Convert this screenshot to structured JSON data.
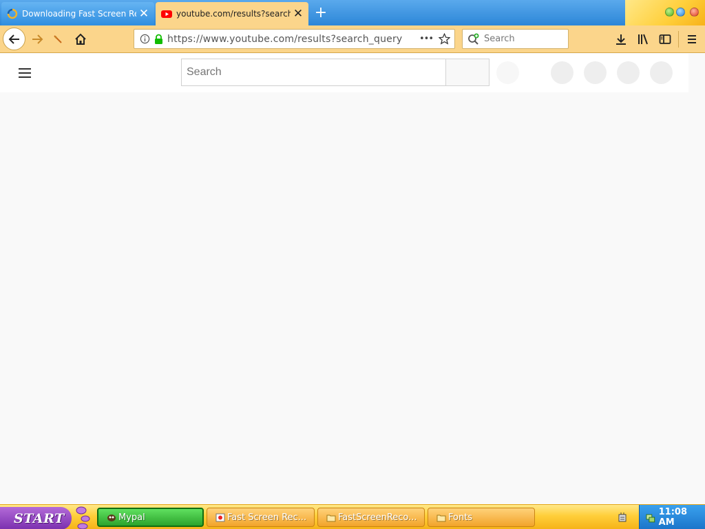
{
  "browser": {
    "tabs": [
      {
        "label": "Downloading Fast Screen Re",
        "active": false
      },
      {
        "label": "youtube.com/results?search",
        "active": true
      }
    ],
    "new_tab_symbol": "+",
    "close_symbol": "✕",
    "address": "https://www.youtube.com/results?search_query",
    "search_placeholder": "Search",
    "page_actions_symbol": "•••"
  },
  "youtube": {
    "search_placeholder": "Search"
  },
  "taskbar": {
    "start_label": "START",
    "tasks": [
      {
        "label": "Mypal",
        "active": true
      },
      {
        "label": "Fast Screen Rec...",
        "active": false
      },
      {
        "label": "FastScreenReco...",
        "active": false
      },
      {
        "label": "Fonts",
        "active": false
      }
    ],
    "clock": "11:08 AM"
  },
  "colors": {
    "toolbar": "#fbd58b",
    "tabstrip": "#2c86d8",
    "youtube_red": "#ff0000",
    "start_purple": "#8a3cbf"
  }
}
